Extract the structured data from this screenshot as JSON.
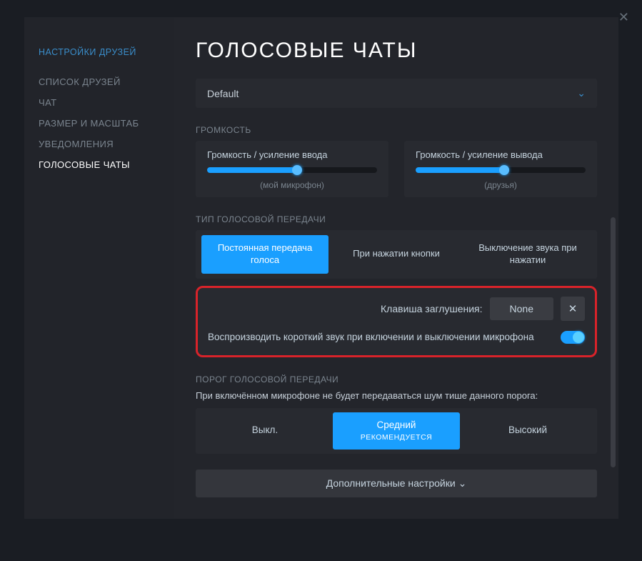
{
  "sidebar": {
    "title": "НАСТРОЙКИ ДРУЗЕЙ",
    "items": [
      {
        "label": "СПИСОК ДРУЗЕЙ"
      },
      {
        "label": "ЧАТ"
      },
      {
        "label": "РАЗМЕР И МАСШТАБ"
      },
      {
        "label": "УВЕДОМЛЕНИЯ"
      },
      {
        "label": "ГОЛОСОВЫЕ ЧАТЫ"
      }
    ]
  },
  "page": {
    "title": "ГОЛОСОВЫЕ ЧАТЫ",
    "device_selected": "Default"
  },
  "volume": {
    "section_label": "ГРОМКОСТЬ",
    "input": {
      "label": "Громкость / усиление ввода",
      "sub": "(мой микрофон)",
      "percent": 53
    },
    "output": {
      "label": "Громкость / усиление вывода",
      "sub": "(друзья)",
      "percent": 52
    }
  },
  "voice_type": {
    "section_label": "ТИП ГОЛОСОВОЙ ПЕРЕДАЧИ",
    "tabs": [
      {
        "label": "Постоянная передача голоса"
      },
      {
        "label": "При нажатии кнопки"
      },
      {
        "label": "Выключение звука при нажатии"
      }
    ]
  },
  "mute": {
    "key_label": "Клавиша заглушения:",
    "key_value": "None",
    "clear": "✕",
    "toggle_label": "Воспроизводить короткий звук при включении и выключении микрофона"
  },
  "threshold": {
    "section_label": "ПОРОГ ГОЛОСОВОЙ ПЕРЕДАЧИ",
    "desc": "При включённом микрофоне не будет передаваться шум тише данного порога:",
    "options": [
      {
        "label": "Выкл.",
        "sub": ""
      },
      {
        "label": "Средний",
        "sub": "РЕКОМЕНДУЕТСЯ"
      },
      {
        "label": "Высокий",
        "sub": ""
      }
    ]
  },
  "advanced": {
    "label": "Дополнительные настройки",
    "chev": "⌄"
  }
}
